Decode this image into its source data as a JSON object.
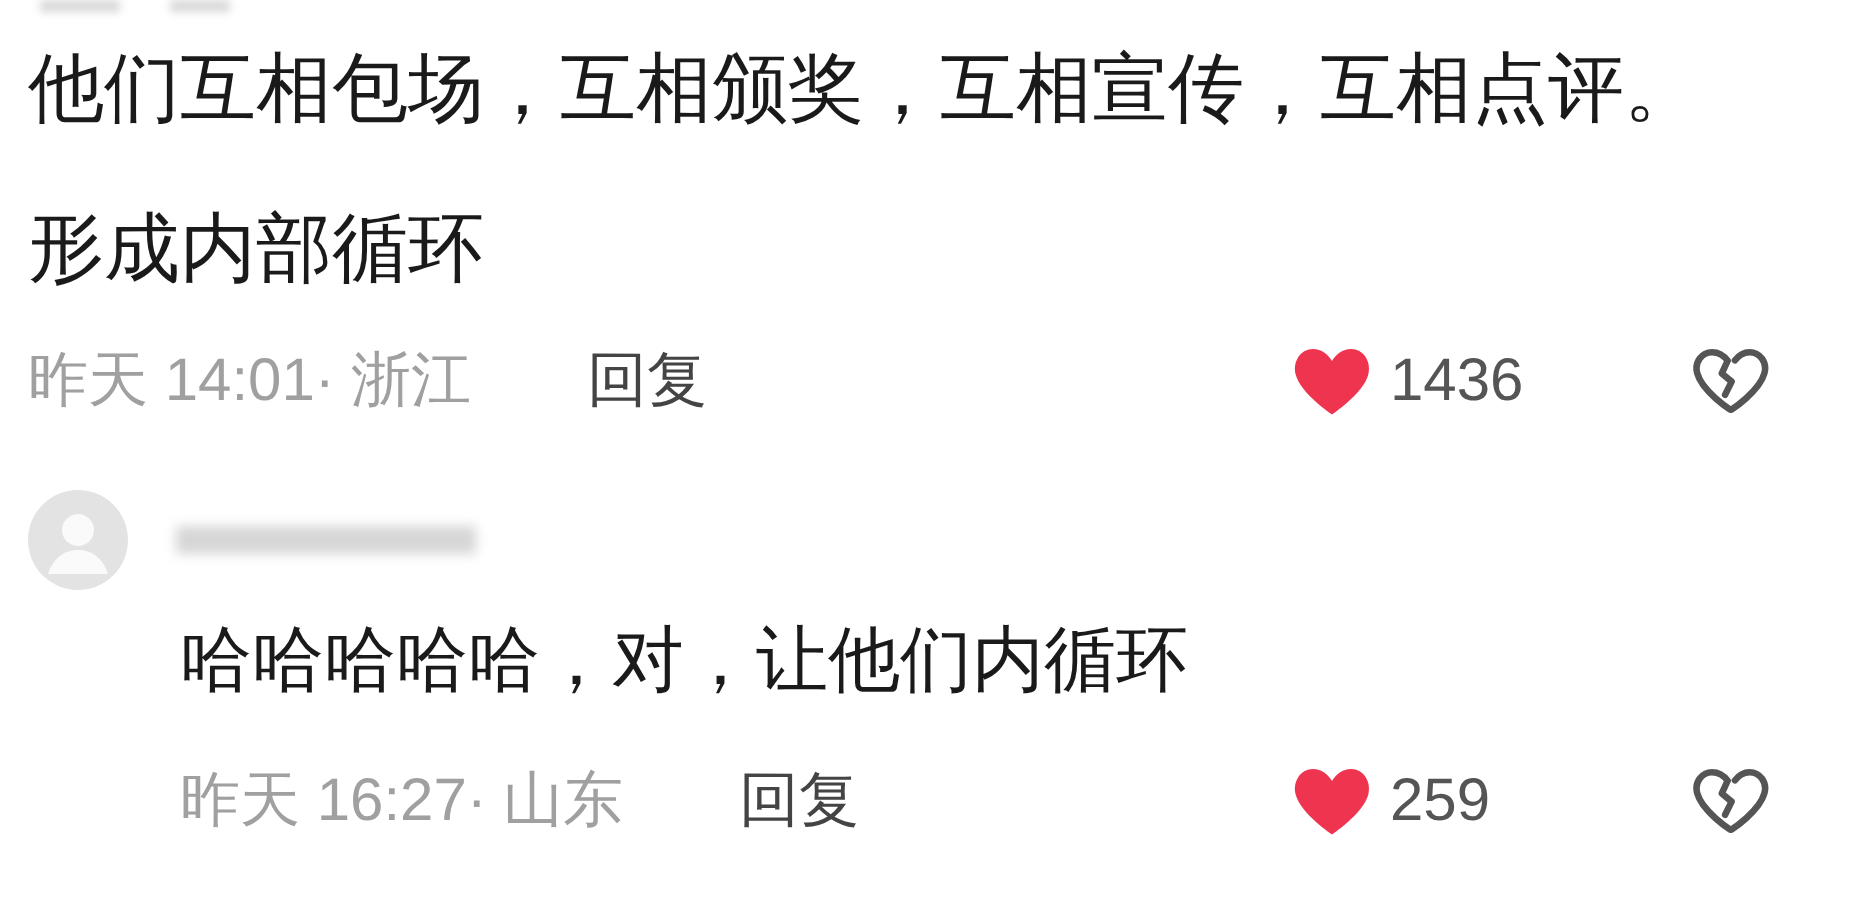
{
  "comments": [
    {
      "has_avatar": false,
      "text": "他们互相包场，互相颁奖，互相宣传，互相点评。形成内部循环",
      "time": "昨天 14:01· 浙江",
      "reply": "回复",
      "liked": true,
      "likes": "1436"
    },
    {
      "has_avatar": true,
      "text": "哈哈哈哈哈，对，让他们内循环",
      "time": "昨天 16:27· 山东",
      "reply": "回复",
      "liked": true,
      "likes": "259"
    }
  ]
}
